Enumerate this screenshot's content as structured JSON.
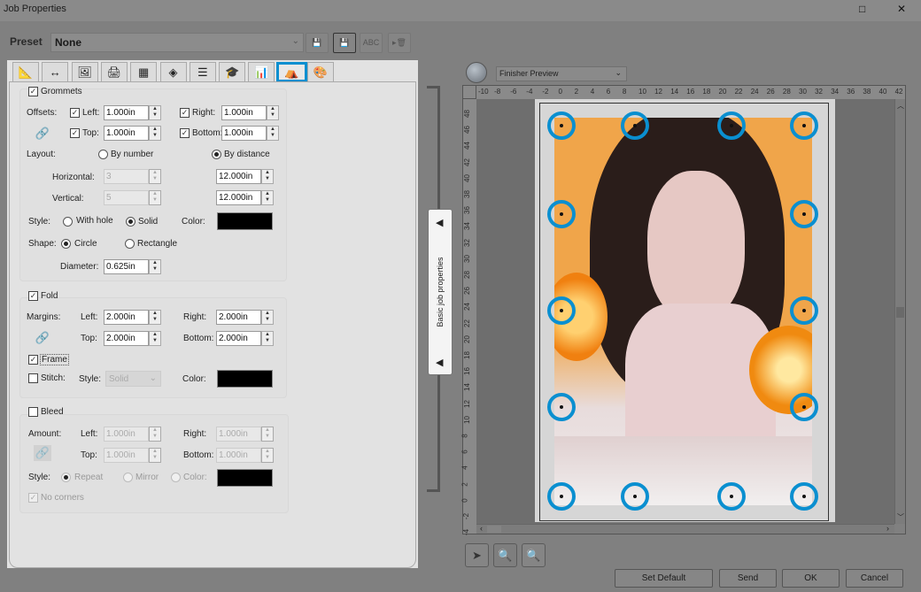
{
  "window": {
    "title": "Job Properties",
    "minimize_icon": "□",
    "close_icon": "✕"
  },
  "preset": {
    "label": "Preset",
    "value": "None",
    "buttons": [
      "save-icon",
      "save-as-icon",
      "rename-icon",
      "delete-icon"
    ],
    "rename_text": "ABC"
  },
  "tabs": {
    "icons": [
      "📐",
      "↔",
      "🖼",
      "🖨",
      "▦",
      "◈",
      "☰",
      "🎓",
      "📊",
      "⛺",
      "🎨"
    ],
    "selected_index": 9,
    "accent": "#0a8fd0",
    "tab_count": 11
  },
  "grommets": {
    "label": "Grommets",
    "checked": true,
    "offsets_label": "Offsets:",
    "left_label": "Left:",
    "left": "1.000in",
    "right_label": "Right:",
    "right": "1.000in",
    "top_label": "Top:",
    "top": "1.000in",
    "bottom_label": "Bottom:",
    "bottom": "1.000in",
    "layout_label": "Layout:",
    "by_number": "By number",
    "by_distance": "By distance",
    "layout_selected": "By distance",
    "horizontal_label": "Horizontal:",
    "horizontal_number": "3",
    "horizontal_distance": "12.000in",
    "vertical_label": "Vertical:",
    "vertical_number": "5",
    "vertical_distance": "12.000in",
    "style_label": "Style:",
    "with_hole": "With hole",
    "solid": "Solid",
    "style_selected": "Solid",
    "color_label": "Color:",
    "color": "#000000",
    "shape_label": "Shape:",
    "circle": "Circle",
    "rectangle": "Rectangle",
    "shape_selected": "Circle",
    "diameter_label": "Diameter:",
    "diameter": "0.625in"
  },
  "fold": {
    "label": "Fold",
    "checked": true,
    "margins_label": "Margins:",
    "left_label": "Left:",
    "left": "2.000in",
    "right_label": "Right:",
    "right": "2.000in",
    "top_label": "Top:",
    "top": "2.000in",
    "bottom_label": "Bottom:",
    "bottom": "2.000in",
    "frame_label": "Frame",
    "frame_checked": true,
    "stitch_label": "Stitch:",
    "stitch_checked": false,
    "style_label": "Style:",
    "style_value": "Solid",
    "color_label": "Color:",
    "color": "#000000"
  },
  "bleed": {
    "label": "Bleed",
    "checked": false,
    "amount_label": "Amount:",
    "left_label": "Left:",
    "left": "1.000in",
    "right_label": "Right:",
    "right": "1.000in",
    "top_label": "Top:",
    "top": "1.000in",
    "bottom_label": "Bottom:",
    "bottom": "1.000in",
    "style_label": "Style:",
    "repeat": "Repeat",
    "mirror": "Mirror",
    "color_label": "Color:",
    "no_corners": "No corners",
    "no_corners_checked": true
  },
  "side_panel": {
    "label": "Basic job properties"
  },
  "preview": {
    "mode": "Finisher Preview",
    "h_ruler": [
      "-10",
      "-8",
      "-6",
      "-4",
      "-2",
      "0",
      "2",
      "4",
      "6",
      "8",
      "10",
      "12",
      "14",
      "16",
      "18",
      "20",
      "22",
      "24",
      "26",
      "28",
      "30",
      "32",
      "34",
      "36",
      "38",
      "40",
      "42"
    ],
    "v_ruler": [
      "48",
      "46",
      "44",
      "42",
      "40",
      "38",
      "36",
      "34",
      "32",
      "30",
      "28",
      "26",
      "24",
      "22",
      "20",
      "18",
      "16",
      "14",
      "12",
      "10",
      "8",
      "6",
      "4",
      "2",
      "0",
      "-2",
      "-4"
    ],
    "grommet_color": "#0a8fd0"
  },
  "tools": [
    "pointer-icon",
    "zoom-region-icon",
    "zoom-icon"
  ],
  "buttons": {
    "set_default": "Set Default",
    "send": "Send",
    "ok": "OK",
    "cancel": "Cancel"
  }
}
